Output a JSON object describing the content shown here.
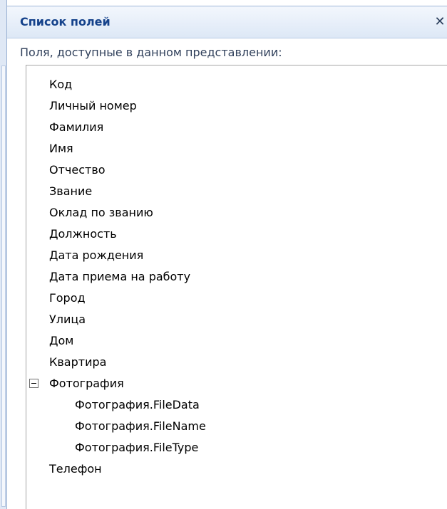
{
  "panel": {
    "title": "Список полей",
    "close_icon": "close-icon",
    "subtitle": "Поля, доступные в данном представлении:"
  },
  "fields": [
    "Код",
    "Личный номер",
    "Фамилия",
    "Имя",
    "Отчество",
    "Звание",
    "Оклад по званию",
    "Должность",
    "Дата рождения",
    "Дата приема на работу",
    "Город",
    "Улица",
    "Дом",
    "Квартира"
  ],
  "group": {
    "label": "Фотография",
    "expanded": true,
    "children": [
      "Фотография.FileData",
      "Фотография.FileName",
      "Фотография.FileType"
    ]
  },
  "after_group": [
    "Телефон"
  ],
  "colors": {
    "title_text": "#15428b",
    "title_bar": "#dde8f6",
    "list_border": "#a5a5a5"
  }
}
